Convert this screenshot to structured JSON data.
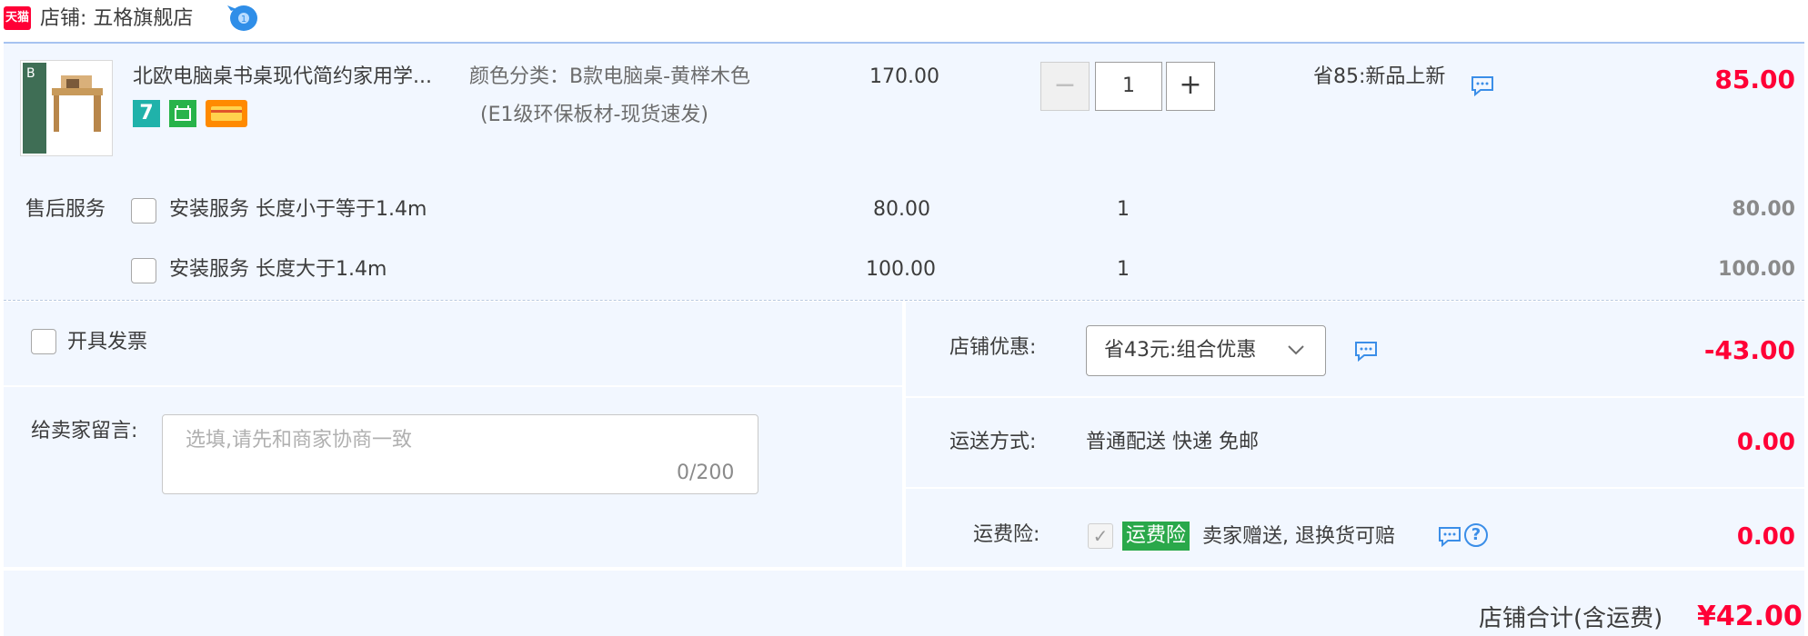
{
  "shop": {
    "label": "店铺: 五格旗舰店",
    "logo_text": "天猫",
    "chat_icon": "wangwang-icon"
  },
  "item": {
    "title": "北欧电脑桌书桌现代简约家用学...",
    "badges": [
      "7",
      "box-badge-icon",
      "card-badge-icon"
    ],
    "sku_line1": "颜色分类：B款电脑桌-黄榉木色",
    "sku_line2": "(E1级环保板材-现货速发)",
    "price": "170.00",
    "quantity": "1",
    "promo": "省85:新品上新",
    "total": "85.00"
  },
  "aftersale": {
    "label": "售后服务",
    "services": [
      {
        "name": "安装服务  长度小于等于1.4m",
        "price": "80.00",
        "qty": "1",
        "total": "80.00"
      },
      {
        "name": "安装服务  长度大于1.4m",
        "price": "100.00",
        "qty": "1",
        "total": "100.00"
      }
    ]
  },
  "invoice": {
    "label": "开具发票"
  },
  "message": {
    "label": "给卖家留言:",
    "placeholder": "选填,请先和商家协商一致",
    "counter": "0/200"
  },
  "coupon": {
    "label": "店铺优惠:",
    "selected": "省43元:组合优惠",
    "amount": "-43.00"
  },
  "shipping": {
    "label": "运送方式:",
    "method": "普通配送  快递  免邮",
    "amount": "0.00"
  },
  "insurance": {
    "label": "运费险:",
    "badge": "运费险",
    "text": "卖家赠送, 退换货可赔",
    "amount": "0.00"
  },
  "footer": {
    "label": "店铺合计(含运费)",
    "total": "¥42.00"
  },
  "colors": {
    "accent_red": "#ff0036",
    "panel_bg": "#f2f7ff",
    "insurance_green": "#2aa84a"
  }
}
